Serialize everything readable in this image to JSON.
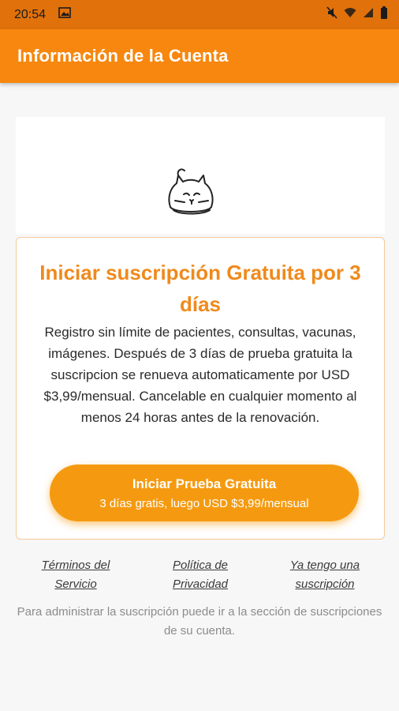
{
  "status": {
    "time": "20:54",
    "icons": [
      "image-icon",
      "mute-icon",
      "wifi-icon",
      "signal-icon",
      "battery-icon"
    ]
  },
  "header": {
    "title": "Información de la Cuenta"
  },
  "colors": {
    "accent": "#f7870e",
    "status_bar": "#e0710b",
    "button": "#f59a10",
    "title_orange": "#ef8a1c"
  },
  "offer": {
    "title": "Iniciar suscripción Gratuita por 3 días",
    "description": "Registro sin límite de pacientes, consultas, vacunas, imágenes. Después de 3 días de prueba gratuita la suscripcion se renueva automaticamente por USD $3,99/mensual. Cancelable en cualquier momento al menos 24 horas antes de la renovación.",
    "button_label": "Iniciar Prueba Gratuita",
    "button_sublabel": "3 días gratis, luego USD $3,99/mensual"
  },
  "links": {
    "terms": "Términos del Servicio",
    "privacy": "Política de Privacidad",
    "restore": "Ya tengo una suscripción"
  },
  "footer": {
    "note": "Para administrar la suscripción puede ir a la sección de suscripciones de su cuenta."
  }
}
